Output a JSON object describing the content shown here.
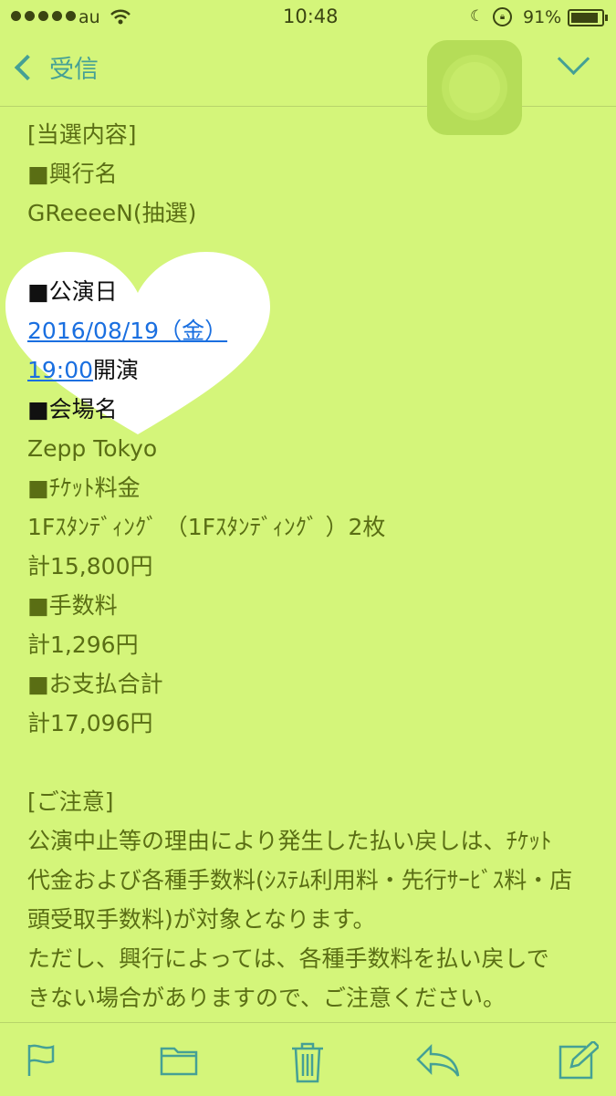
{
  "status": {
    "carrier": "au",
    "time": "10:48",
    "battery": "91%"
  },
  "nav": {
    "back_label": "受信"
  },
  "mail": {
    "l1": "[当選内容]",
    "l2": "■興行名",
    "l3": "GReeeeN(抽選)",
    "l4": "■公演日",
    "date_link": "2016/08/19（金）",
    "time_link": "19:00",
    "time_suffix": "開演",
    "l6": "■会場名",
    "l7": "Zepp Tokyo",
    "l8": "■ﾁｹｯﾄ料金",
    "l9": "1Fｽﾀﾝﾃﾞｨﾝｸﾞ （1Fｽﾀﾝﾃﾞｨﾝｸﾞ ）2枚",
    "l10": "計15,800円",
    "l11": "■手数料",
    "l12": "計1,296円",
    "l13": "■お支払合計",
    "l14": "計17,096円",
    "l15": "[ご注意]",
    "l16": "公演中止等の理由により発生した払い戻しは、ﾁｹｯﾄ",
    "l17": "代金および各種手数料(ｼｽﾃﾑ利用料・先行ｻｰﾋﾞｽ料・店",
    "l18": "頭受取手数料)が対象となります。",
    "l19": "ただし、興行によっては、各種手数料を払い戻しで",
    "l20": "きない場合がありますので、ご注意ください。"
  },
  "toolbar": {
    "icons": [
      "flag-icon",
      "folder-icon",
      "trash-icon",
      "reply-icon",
      "compose-icon"
    ]
  }
}
